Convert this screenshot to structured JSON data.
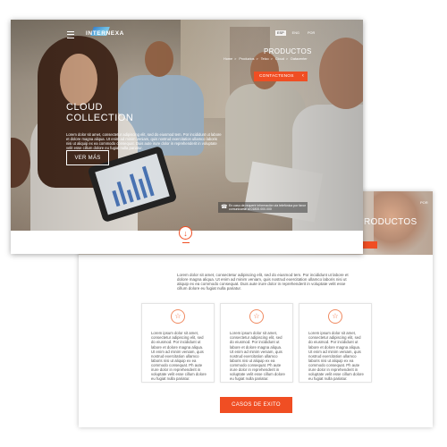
{
  "header": {
    "logo_text": "INTERNEXA",
    "languages": [
      "ESP",
      "ENG",
      "POR"
    ],
    "active_language": "ESP"
  },
  "page": {
    "title": "PRODUCTOS",
    "breadcrumb": [
      "Home",
      "Productos",
      "Telco",
      "Cloud",
      "Datacenter"
    ],
    "contact_label": "CONTACTENOS"
  },
  "hero": {
    "title_line1": "CLOUD",
    "title_line2": "COLLECTION",
    "description": "Lorem dolor sit amet, consectetur adipiscing elit, sed do eiusmod tem. Por incididunt ut labore et dolore magna aliqua. Ut enim ad minim veniam, quis nostrud exercitation ullamco laboris nisi ut aliquip ex ea commodo consequat. Duis aute irure dolor in reprehenderit in voluptate velit esse cillum dolore eu fugiat nulla pariatur.",
    "cta_label": "VER MÁS",
    "phone_text": "En caso de requerir información vía telefónica por favor comunicarse al 01800.000.000"
  },
  "intro_text": "Lorem dolor sit amet, consectetur adipiscing elit, sed do eiusmod tem. Por incididunt ut labore et dolore magna aliqua. Ut enim ad minim veniam, quis nostrud exercitation ullamco laboris nisi ut aliquip ex ea commodo consequat. Duis aute irure dolor in reprehenderit in voluptate velit esse cillum dolore eu fugiat nulla pariatur.",
  "cards": [
    {
      "text": "Lorem ipsum dolor sit amet, consectetur adipiscing elit, sed do eiusmod. Por incididunt ut labore et dolore magna aliqua. Ut enim ad minim veniam, quis nostrud exercitation ullamco laboris nisi ut aliquip ex ea commodo consequat. Ph aute irure dolor in reprehenderit in voluptate velit esse cillum dolore eu fugiat nulla pariatur."
    },
    {
      "text": "Lorem ipsum dolor sit amet, consectetur adipiscing elit, sed do eiusmod. Por incididunt ut labore et dolore magna aliqua. Ut enim ad minim veniam, quis nostrud exercitation ullamco laboris nisi ut aliquip ex ea commodo consequat. Ph aute irure dolor in reprehenderit in voluptate velit esse cillum dolore eu fugiat nulla pariatur."
    },
    {
      "text": "Lorem ipsum dolor sit amet, consectetur adipiscing elit, sed do eiusmod. Por incididunt ut labore et dolore magna aliqua. Ut enim ad minim veniam, quis nostrud exercitation ullamco laboris nisi ut aliquip ex ea commodo consequat. Ph aute irure dolor in reprehenderit in voluptate velit esse cillum dolore eu fugiat nulla pariatur."
    }
  ],
  "casos_label": "CASOS DE EXITO",
  "back_preview": {
    "title": "PRODUCTOS",
    "language": "POR"
  },
  "colors": {
    "accent": "#f04e23",
    "text": "#555555",
    "card_border": "#e4e4e4",
    "logo_blue": "#2c7fd6"
  },
  "icons": {
    "menu": "hamburger-icon",
    "chevron": "chevron-left-icon",
    "phone": "phone-icon",
    "scroll": "arrow-down-circle-icon",
    "card": "star-badge-icon"
  }
}
